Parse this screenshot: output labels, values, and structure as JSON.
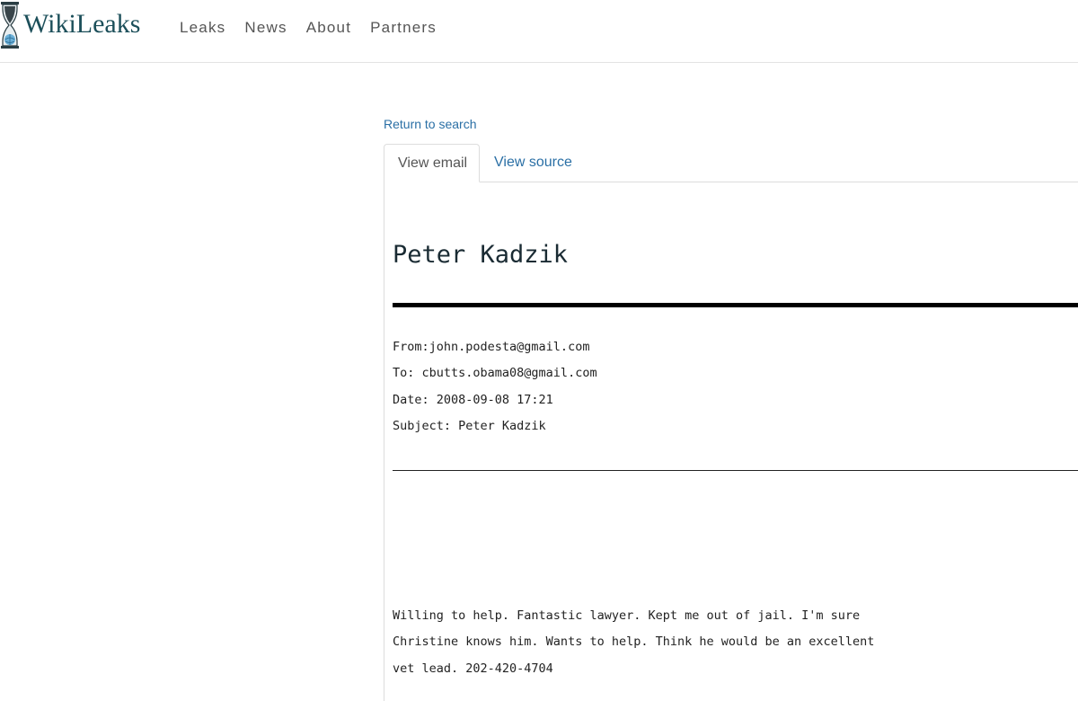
{
  "brand": {
    "name": "WikiLeaks",
    "logo_icon": "hourglass-globe-icon",
    "color": "#1c4f5a"
  },
  "nav": {
    "items": [
      "Leaks",
      "News",
      "About",
      "Partners"
    ]
  },
  "return_link": "Return to search",
  "tabs": {
    "active": "View email",
    "inactive": "View source"
  },
  "email": {
    "title": "Peter Kadzik",
    "from": "From:john.podesta@gmail.com",
    "to": "To: cbutts.obama08@gmail.com",
    "date": "Date: 2008-09-08 17:21",
    "subject": "Subject: Peter Kadzik",
    "body_lines": [
      "Willing to help. Fantastic lawyer. Kept me out of jail. I'm sure",
      "Christine knows him. Wants to help. Think he would be an excellent",
      "vet lead. 202-420-4704"
    ]
  },
  "colors": {
    "link": "#2a6fa5",
    "nav_text": "#555555"
  }
}
